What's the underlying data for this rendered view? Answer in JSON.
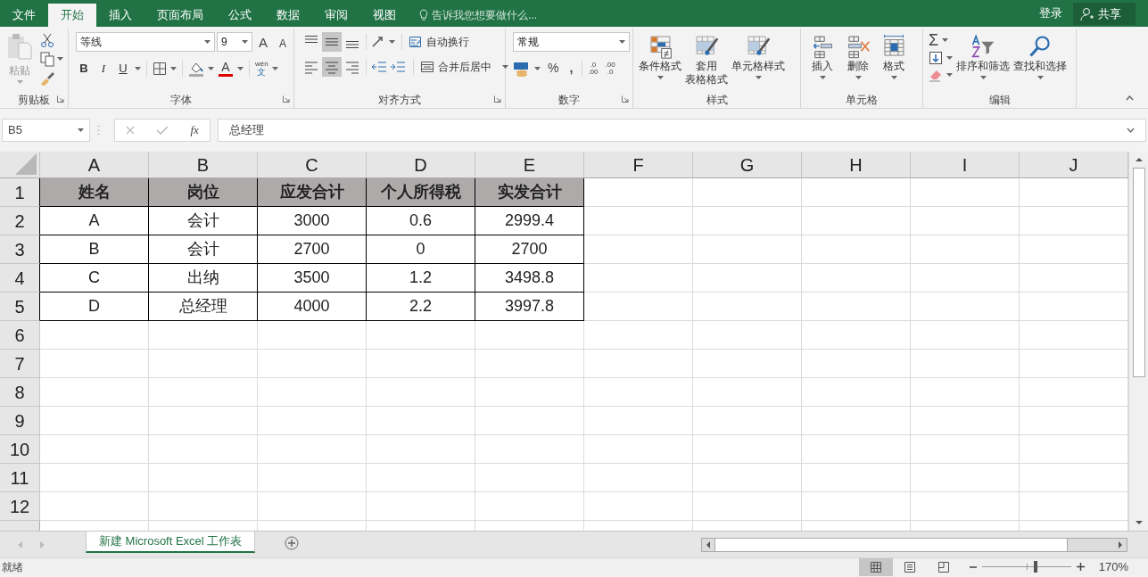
{
  "title_bar": {
    "tabs": [
      {
        "label": "文件",
        "selected": false
      },
      {
        "label": "开始",
        "selected": true
      },
      {
        "label": "插入",
        "selected": false
      },
      {
        "label": "页面布局",
        "selected": false
      },
      {
        "label": "公式",
        "selected": false
      },
      {
        "label": "数据",
        "selected": false
      },
      {
        "label": "审阅",
        "selected": false
      },
      {
        "label": "视图",
        "selected": false
      }
    ],
    "tell_me": {
      "placeholder": "告诉我您想要做什么..."
    },
    "sign_in": "登录",
    "share": "共享"
  },
  "ribbon": {
    "clipboard": {
      "label": "剪贴板",
      "paste": "粘贴"
    },
    "font": {
      "label": "字体",
      "font_name": "等线",
      "font_size": "9",
      "grow": "A",
      "shrink": "A",
      "bold": "B",
      "italic": "I",
      "underline": "U",
      "font_color": "A",
      "phonetic": [
        "wén",
        "文"
      ]
    },
    "alignment": {
      "label": "对齐方式",
      "vertical": [
        {
          "selected": false
        },
        {
          "selected": true
        },
        {
          "selected": false
        }
      ],
      "horizontal": [
        {
          "selected": false
        },
        {
          "selected": true
        },
        {
          "selected": false
        }
      ],
      "wrap_text": "自动换行",
      "merge_center": "合并后居中"
    },
    "number": {
      "label": "数字",
      "format": "常规",
      "percent": "%",
      "comma": ",",
      "increase_decimal": [
        ".0",
        ".00"
      ],
      "decrease_decimal": [
        ".00",
        ".0"
      ]
    },
    "styles": {
      "label": "样式",
      "buttons": [
        {
          "lines": [
            "条件格式"
          ]
        },
        {
          "lines": [
            "套用",
            "表格格式"
          ]
        },
        {
          "lines": [
            "单元格样式"
          ]
        }
      ]
    },
    "cells": {
      "label": "单元格",
      "buttons": [
        {
          "lines": [
            "插入"
          ]
        },
        {
          "lines": [
            "删除"
          ]
        },
        {
          "lines": [
            "格式"
          ]
        }
      ]
    },
    "editing": {
      "label": "编辑",
      "autosum": "Σ",
      "buttons": [
        {
          "lines": [
            "排序和筛选"
          ]
        },
        {
          "lines": [
            "查找和选择"
          ]
        }
      ]
    }
  },
  "formula_bar": {
    "name_box": "B5",
    "fx": "fx",
    "formula": "总经理"
  },
  "sheet": {
    "columns": [
      "A",
      "B",
      "C",
      "D",
      "E",
      "F",
      "G",
      "H",
      "I",
      "J"
    ],
    "row_numbers": [
      "1",
      "2",
      "3",
      "4",
      "5",
      "6",
      "7",
      "8",
      "9",
      "10",
      "11",
      "12"
    ],
    "header": [
      "姓名",
      "岗位",
      "应发合计",
      "个人所得税",
      "实发合计"
    ],
    "rows": [
      [
        "A",
        "会计",
        "3000",
        "0.6",
        "2999.4"
      ],
      [
        "B",
        "会计",
        "2700",
        "0",
        "2700"
      ],
      [
        "C",
        "出纳",
        "3500",
        "1.2",
        "3498.8"
      ],
      [
        "D",
        "总经理",
        "4000",
        "2.2",
        "3997.8"
      ]
    ]
  },
  "sheet_tabs": [
    {
      "label": "新建 Microsoft Excel 工作表",
      "selected": true
    }
  ],
  "status_bar": {
    "status": "就绪",
    "views": [
      {
        "selected": true
      },
      {
        "selected": false
      },
      {
        "selected": false
      }
    ],
    "zoom": {
      "level": 0.6,
      "reading": "170%"
    }
  }
}
